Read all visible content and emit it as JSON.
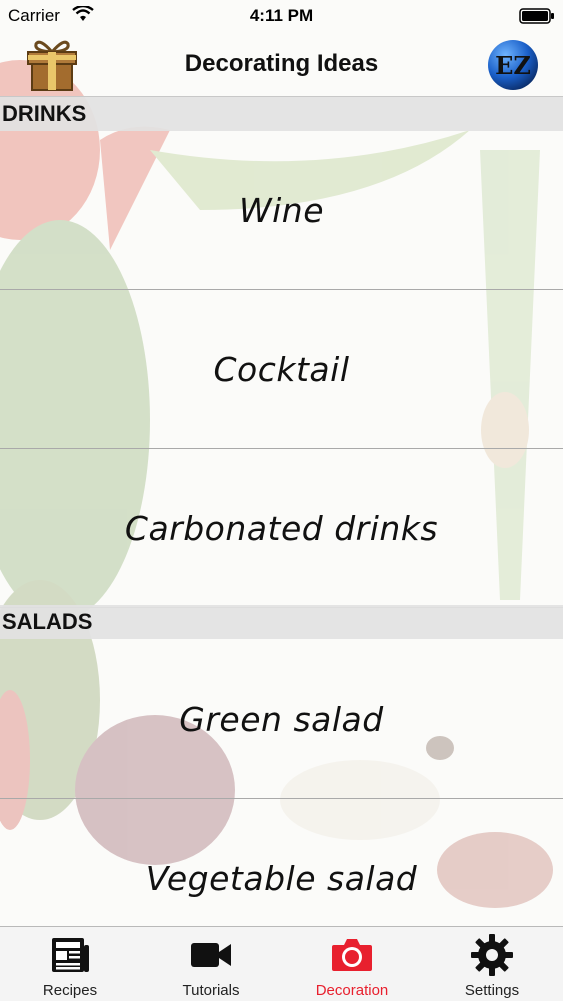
{
  "status_bar": {
    "carrier": "Carrier",
    "time": "4:11 PM"
  },
  "nav": {
    "title": "Decorating Ideas",
    "left_icon": "gift-box-icon",
    "right_icon": "ez-logo-icon",
    "logo_text": "EZ"
  },
  "sections": [
    {
      "header": "DRINKS",
      "items": [
        "Wine",
        "Cocktail",
        "Carbonated drinks"
      ]
    },
    {
      "header": "SALADS",
      "items": [
        "Green salad",
        "Vegetable salad"
      ]
    }
  ],
  "tabs": [
    {
      "label": "Recipes",
      "icon": "newspaper-icon",
      "active": false
    },
    {
      "label": "Tutorials",
      "icon": "video-camera-icon",
      "active": false
    },
    {
      "label": "Decoration",
      "icon": "camera-icon",
      "active": true
    },
    {
      "label": "Settings",
      "icon": "gear-icon",
      "active": false
    }
  ],
  "colors": {
    "active_tab": "#e8202e",
    "section_header_bg": "#e2e2e2",
    "tab_bar_bg": "#f4f4f4"
  }
}
